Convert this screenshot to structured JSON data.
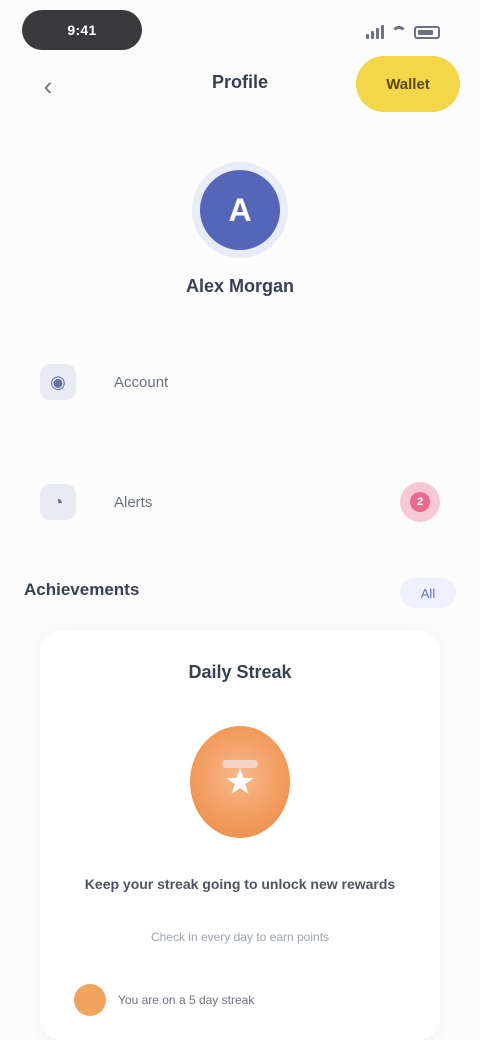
{
  "status_bar": {
    "time": "9:41"
  },
  "nav": {
    "back_icon": "‹",
    "title": "Profile",
    "wallet_label": "Wallet"
  },
  "profile": {
    "avatar_initial": "A",
    "name": "Alex Morgan"
  },
  "rows": [
    {
      "icon": "person-icon",
      "glyph": "◉",
      "label": "Account"
    },
    {
      "icon": "bell-icon",
      "glyph": "◔",
      "label": "Alerts",
      "badge": "2"
    }
  ],
  "section": {
    "title": "Achievements",
    "see_all_label": "All"
  },
  "card": {
    "title": "Daily Streak",
    "emblem_glyph": "★",
    "description": "Keep your streak going to unlock new rewards",
    "subtitle": "Check in every day to earn points",
    "footer": "You are on a 5 day streak"
  },
  "colors": {
    "accent_yellow": "#f3d64a",
    "avatar_blue": "#5566b8",
    "badge_pink": "#e86a8a",
    "emblem_orange": "#f19a5a"
  }
}
